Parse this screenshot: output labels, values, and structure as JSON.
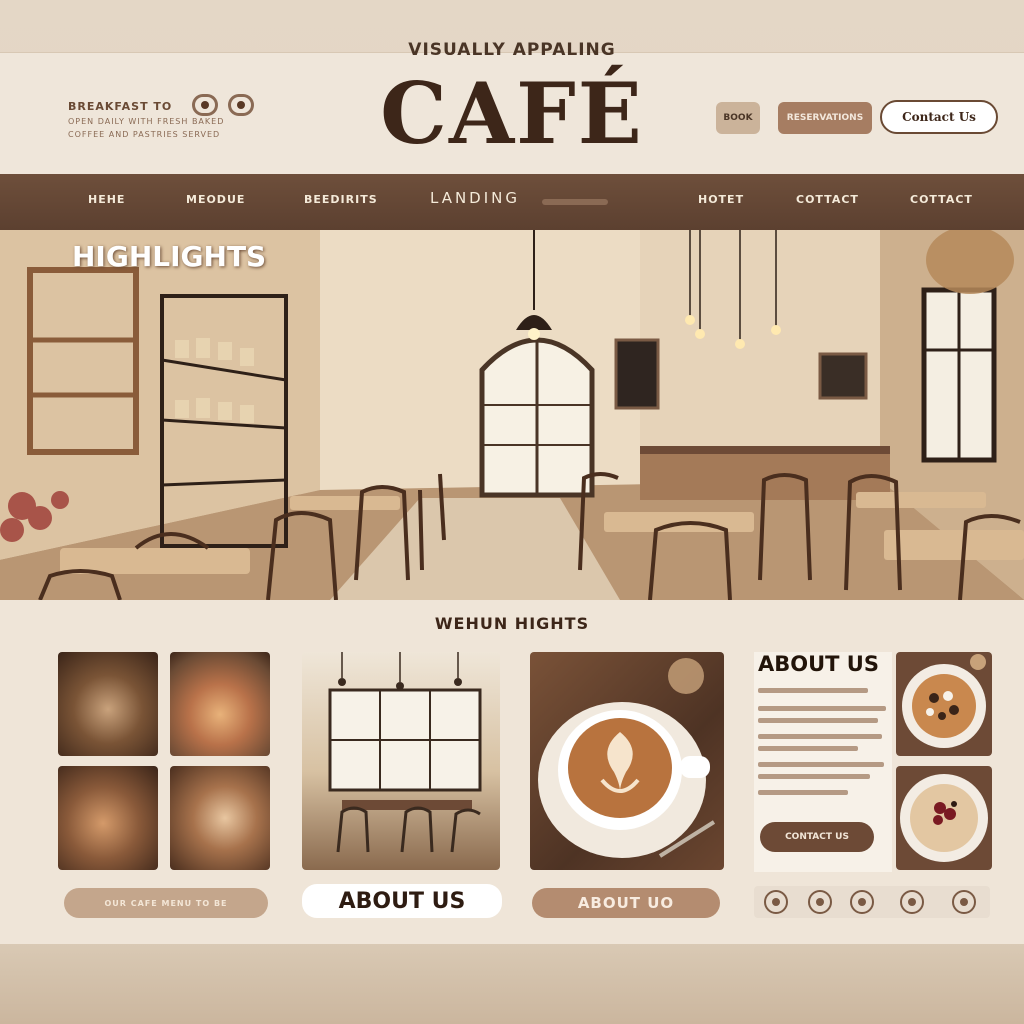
{
  "header": {
    "tagline": "VISUALLY APPALING",
    "brand": "CAFÉ",
    "left_title": "BREAKFAST TO",
    "left_line1": "OPEN DAILY WITH FRESH BAKED",
    "left_line2": "COFFEE AND PASTRIES SERVED",
    "btn_small": "BOOK",
    "btn_mid": "RESERVATIONS",
    "btn_contact": "Contact Us"
  },
  "nav": {
    "items": [
      "HEHE",
      "MEODUE",
      "BEEDIRITS",
      "LANDING",
      "HOTET",
      "COTTACT",
      "COTTACT"
    ]
  },
  "hero": {
    "title": "HIGHLIGHTS"
  },
  "section": {
    "subtitle": "WEHUN HIGHTS",
    "pill_left": "OUR CAFE MENU TO BE",
    "pill_about": "ABOUT US",
    "pill_about2": "ABOUT UO"
  },
  "about": {
    "title": "ABOUT US",
    "button": "CONTACT US"
  },
  "colors": {
    "accent": "#6d4a36",
    "nav_bg": "#5c4030",
    "panel_bg": "#efe5d8"
  }
}
